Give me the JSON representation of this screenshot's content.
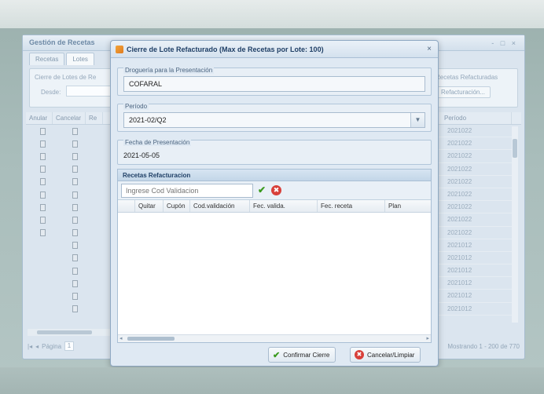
{
  "background_window": {
    "title": "Gestión de Recetas",
    "window_controls": "- □ ×",
    "tabs": [
      "Recetas",
      "Lotes"
    ],
    "left_group_label": "Cierre de Lotes de Re",
    "left_field_label": "Desde:",
    "right_group_label": "Recetas Refacturadas",
    "right_button_label": "Refacturación...",
    "grid_headers": [
      "Anular",
      "Cancelar",
      "Re",
      "Período"
    ],
    "period_values": [
      "2021022",
      "2021022",
      "2021022",
      "2021022",
      "2021022",
      "2021022",
      "2021022",
      "2021022",
      "2021022",
      "2021012",
      "2021012",
      "2021012",
      "2021012",
      "2021012",
      "2021012"
    ],
    "left_rows_with_two_icons": 9,
    "left_rows_total": 15,
    "pager_label": "Página",
    "pager_value": "1",
    "status_text": "Mostrando 1 - 200 de 770"
  },
  "dialog": {
    "title": "Cierre de Lote Refacturado (Max de Recetas por Lote: 100)",
    "close_label": "×",
    "drogueria": {
      "label": "Droguería para la Presentación",
      "value": "COFARAL"
    },
    "periodo": {
      "label": "Período",
      "value": "2021-02/Q2"
    },
    "fecha": {
      "label": "Fecha de Presentación",
      "value": "2021-05-05"
    },
    "recetas_panel": {
      "title": "Recetas Refacturacion",
      "input_placeholder": "Ingrese Cod Validacion",
      "columns": [
        "Quitar",
        "Cupón",
        "Cod.validación",
        "Fec. valida.",
        "Fec. receta",
        "Plan"
      ]
    },
    "buttons": {
      "confirm": "Confirmar Cierre",
      "cancel": "Cancelar/Limpiar"
    }
  },
  "colors": {
    "accent": "#1f3f66",
    "ok_green": "#3a9a1e",
    "cancel_red": "#d8403a"
  }
}
